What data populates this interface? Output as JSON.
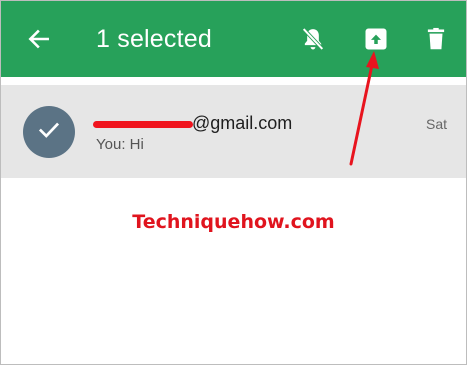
{
  "toolbar": {
    "title": "1 selected",
    "icons": [
      "back-arrow-icon",
      "mute-notifications-icon",
      "archive-icon",
      "delete-icon"
    ],
    "color": "#27a15a"
  },
  "conversation": {
    "email": "@gmail.com",
    "snippet": "You: Hi",
    "date": "Sat",
    "selected": true,
    "avatar_color": "#5b7385"
  },
  "watermark": "Techniquehow.com",
  "annotation": {
    "arrow_color": "#e8141e"
  }
}
